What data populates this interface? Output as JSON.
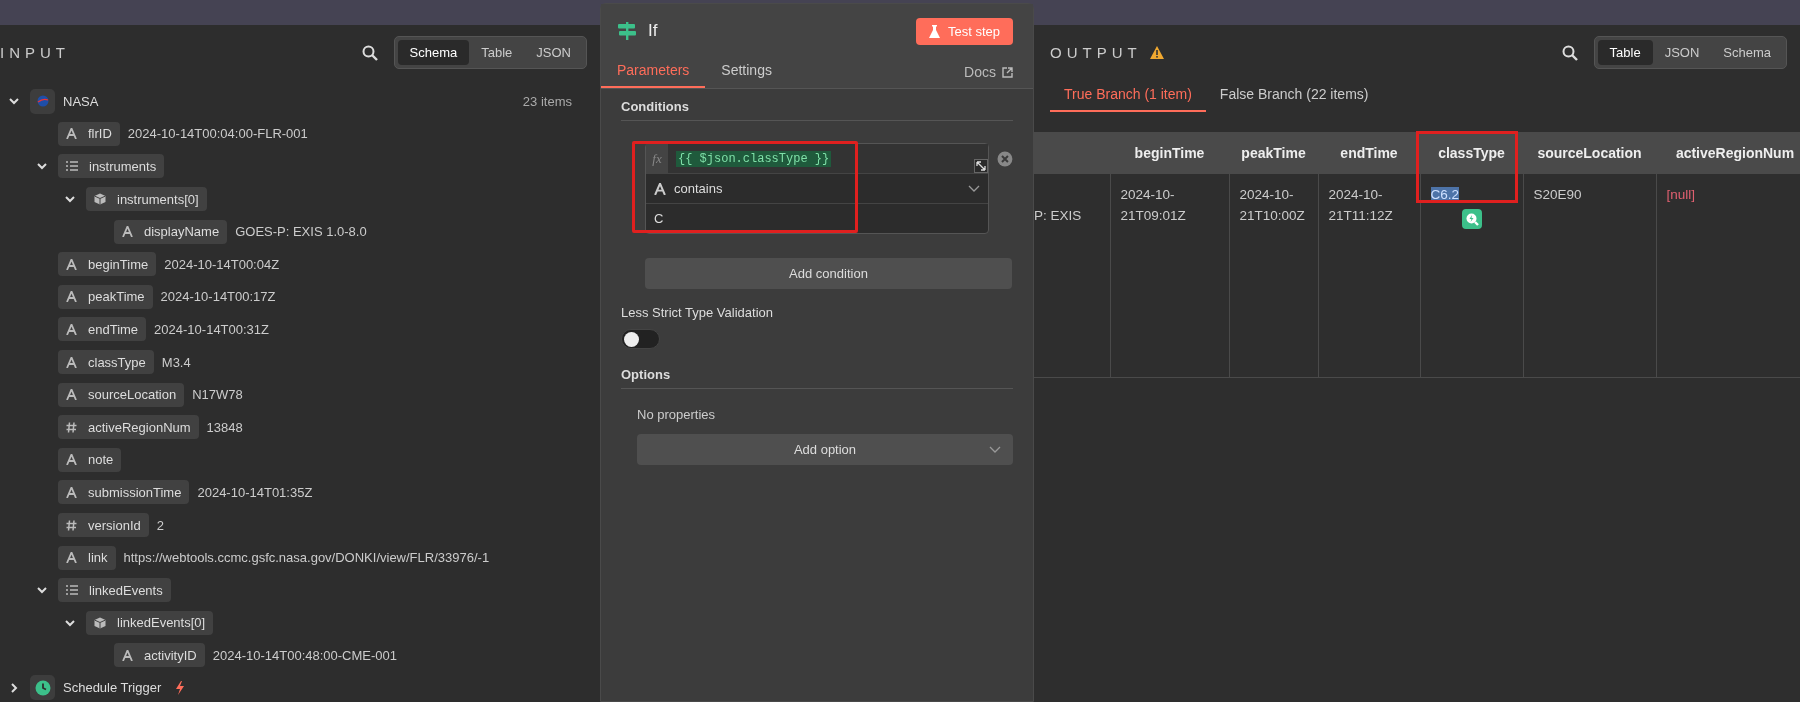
{
  "input_panel": {
    "title": "INPUT",
    "view_tabs": [
      {
        "label": "Schema",
        "selected": true
      },
      {
        "label": "Table",
        "selected": false
      },
      {
        "label": "JSON",
        "selected": false
      }
    ],
    "tree": [
      {
        "kind": "root",
        "name": "NASA",
        "count": "23 items",
        "expanded": true,
        "children": [
          {
            "kind": "string",
            "name": "flrID",
            "value": "2024-10-14T00:04:00-FLR-001"
          },
          {
            "kind": "array",
            "name": "instruments",
            "expanded": true,
            "children": [
              {
                "kind": "object",
                "name": "instruments[0]",
                "expanded": true,
                "children": [
                  {
                    "kind": "string",
                    "name": "displayName",
                    "value": "GOES-P: EXIS 1.0-8.0"
                  }
                ]
              }
            ]
          },
          {
            "kind": "string",
            "name": "beginTime",
            "value": "2024-10-14T00:04Z"
          },
          {
            "kind": "string",
            "name": "peakTime",
            "value": "2024-10-14T00:17Z"
          },
          {
            "kind": "string",
            "name": "endTime",
            "value": "2024-10-14T00:31Z"
          },
          {
            "kind": "string",
            "name": "classType",
            "value": "M3.4"
          },
          {
            "kind": "string",
            "name": "sourceLocation",
            "value": "N17W78"
          },
          {
            "kind": "number",
            "name": "activeRegionNum",
            "value": "13848"
          },
          {
            "kind": "string",
            "name": "note"
          },
          {
            "kind": "string",
            "name": "submissionTime",
            "value": "2024-10-14T01:35Z"
          },
          {
            "kind": "number",
            "name": "versionId",
            "value": "2"
          },
          {
            "kind": "string",
            "name": "link",
            "value": "https://webtools.ccmc.gsfc.nasa.gov/DONKI/view/FLR/33976/-1"
          },
          {
            "kind": "array",
            "name": "linkedEvents",
            "expanded": true,
            "children": [
              {
                "kind": "object",
                "name": "linkedEvents[0]",
                "expanded": true,
                "children": [
                  {
                    "kind": "string",
                    "name": "activityID",
                    "value": "2024-10-14T00:48:00-CME-001"
                  }
                ]
              }
            ]
          }
        ]
      },
      {
        "kind": "trigger",
        "name": "Schedule Trigger",
        "expanded": false
      }
    ]
  },
  "node_panel": {
    "title": "If",
    "test_button": "Test step",
    "tabs": [
      {
        "label": "Parameters",
        "selected": true
      },
      {
        "label": "Settings",
        "selected": false
      }
    ],
    "docs_link": "Docs",
    "conditions": {
      "heading": "Conditions",
      "items": [
        {
          "fx_label": "fx",
          "left": "{{ $json.classType }}",
          "operator": "contains",
          "right": "C"
        }
      ],
      "add_button": "Add condition"
    },
    "less_strict": {
      "label": "Less Strict Type Validation",
      "on": false
    },
    "options": {
      "heading": "Options",
      "empty_text": "No properties",
      "add_button": "Add option"
    }
  },
  "output_panel": {
    "title": "OUTPUT",
    "view_tabs": [
      {
        "label": "Table",
        "selected": true
      },
      {
        "label": "JSON",
        "selected": false
      },
      {
        "label": "Schema",
        "selected": false
      }
    ],
    "branch_tabs": [
      {
        "label": "True Branch (1 item)",
        "selected": true
      },
      {
        "label": "False Branch (22 items)",
        "selected": false
      }
    ],
    "table": {
      "columns": [
        "beginTime",
        "peakTime",
        "endTime",
        "classType",
        "sourceLocation",
        "activeRegionNum"
      ],
      "rows": [
        {
          "column_1": "P: EXIS",
          "cells": [
            {
              "text": "2024-10-21T09:01Z",
              "is_null": false,
              "highlighted": false
            },
            {
              "text": "2024-10-21T10:00Z",
              "is_null": false,
              "highlighted": false
            },
            {
              "text": "2024-10-21T11:12Z",
              "is_null": false,
              "highlighted": false
            },
            {
              "text": "C6.2",
              "is_null": false,
              "highlighted": true
            },
            {
              "text": "S20E90",
              "is_null": false,
              "highlighted": false
            },
            {
              "text": "[null]",
              "is_null": true,
              "highlighted": false
            }
          ]
        }
      ]
    }
  }
}
